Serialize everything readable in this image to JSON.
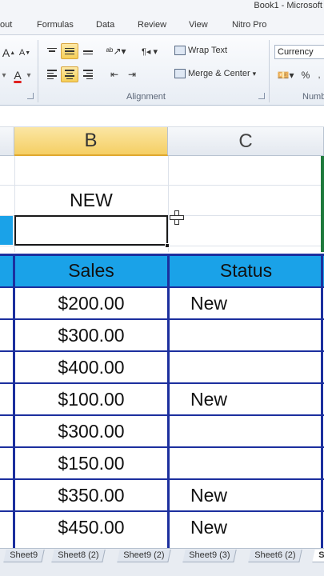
{
  "window": {
    "title": "Book1 - Microsoft"
  },
  "ribbon_tabs": [
    "out",
    "Formulas",
    "Data",
    "Review",
    "View",
    "Nitro Pro"
  ],
  "ribbon": {
    "font_size_up": "A",
    "font_size_down": "A",
    "font_color_label": "A",
    "wrap_text": "Wrap Text",
    "merge_center": "Merge & Center",
    "alignment_group": "Alignment",
    "number_format": "Currency",
    "number_group": "Numb",
    "percent": "%"
  },
  "columns": [
    "B",
    "C"
  ],
  "cells": {
    "b2": "NEW"
  },
  "table": {
    "headers": [
      "Sales",
      "Status"
    ],
    "rows": [
      [
        "$200.00",
        "New"
      ],
      [
        "$300.00",
        ""
      ],
      [
        "$400.00",
        ""
      ],
      [
        "$100.00",
        "New"
      ],
      [
        "$300.00",
        ""
      ],
      [
        "$150.00",
        ""
      ],
      [
        "$350.00",
        "New"
      ],
      [
        "$450.00",
        "New"
      ]
    ]
  },
  "sheet_tabs": [
    "Sheet9",
    "Sheet8 (2)",
    "Sheet9 (2)",
    "Sheet9 (3)",
    "Sheet6 (2)",
    "S"
  ],
  "active_sheet_index": 5,
  "colors": {
    "table_header": "#1aa2e8",
    "table_border": "#1c2f9e",
    "selected_column": "#f5cf64"
  }
}
